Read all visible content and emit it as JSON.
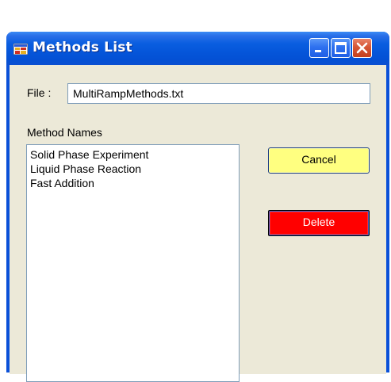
{
  "window": {
    "title": "Methods List",
    "title_color": "#ffffff",
    "titlebar_color": "#0a5ee0",
    "client_color": "#ece9d8"
  },
  "titlebar_buttons": {
    "minimize_icon": "minimize-icon",
    "maximize_icon": "maximize-icon",
    "close_icon": "close-icon"
  },
  "file": {
    "label": "File :",
    "value": "MultiRampMethods.txt"
  },
  "methods": {
    "label": "Method Names",
    "items": [
      "Solid Phase Experiment",
      "Liquid Phase Reaction",
      "Fast Addition"
    ]
  },
  "buttons": {
    "cancel_label": "Cancel",
    "cancel_color": "#ffff80",
    "delete_label": "Delete",
    "delete_color": "#ff0000"
  }
}
